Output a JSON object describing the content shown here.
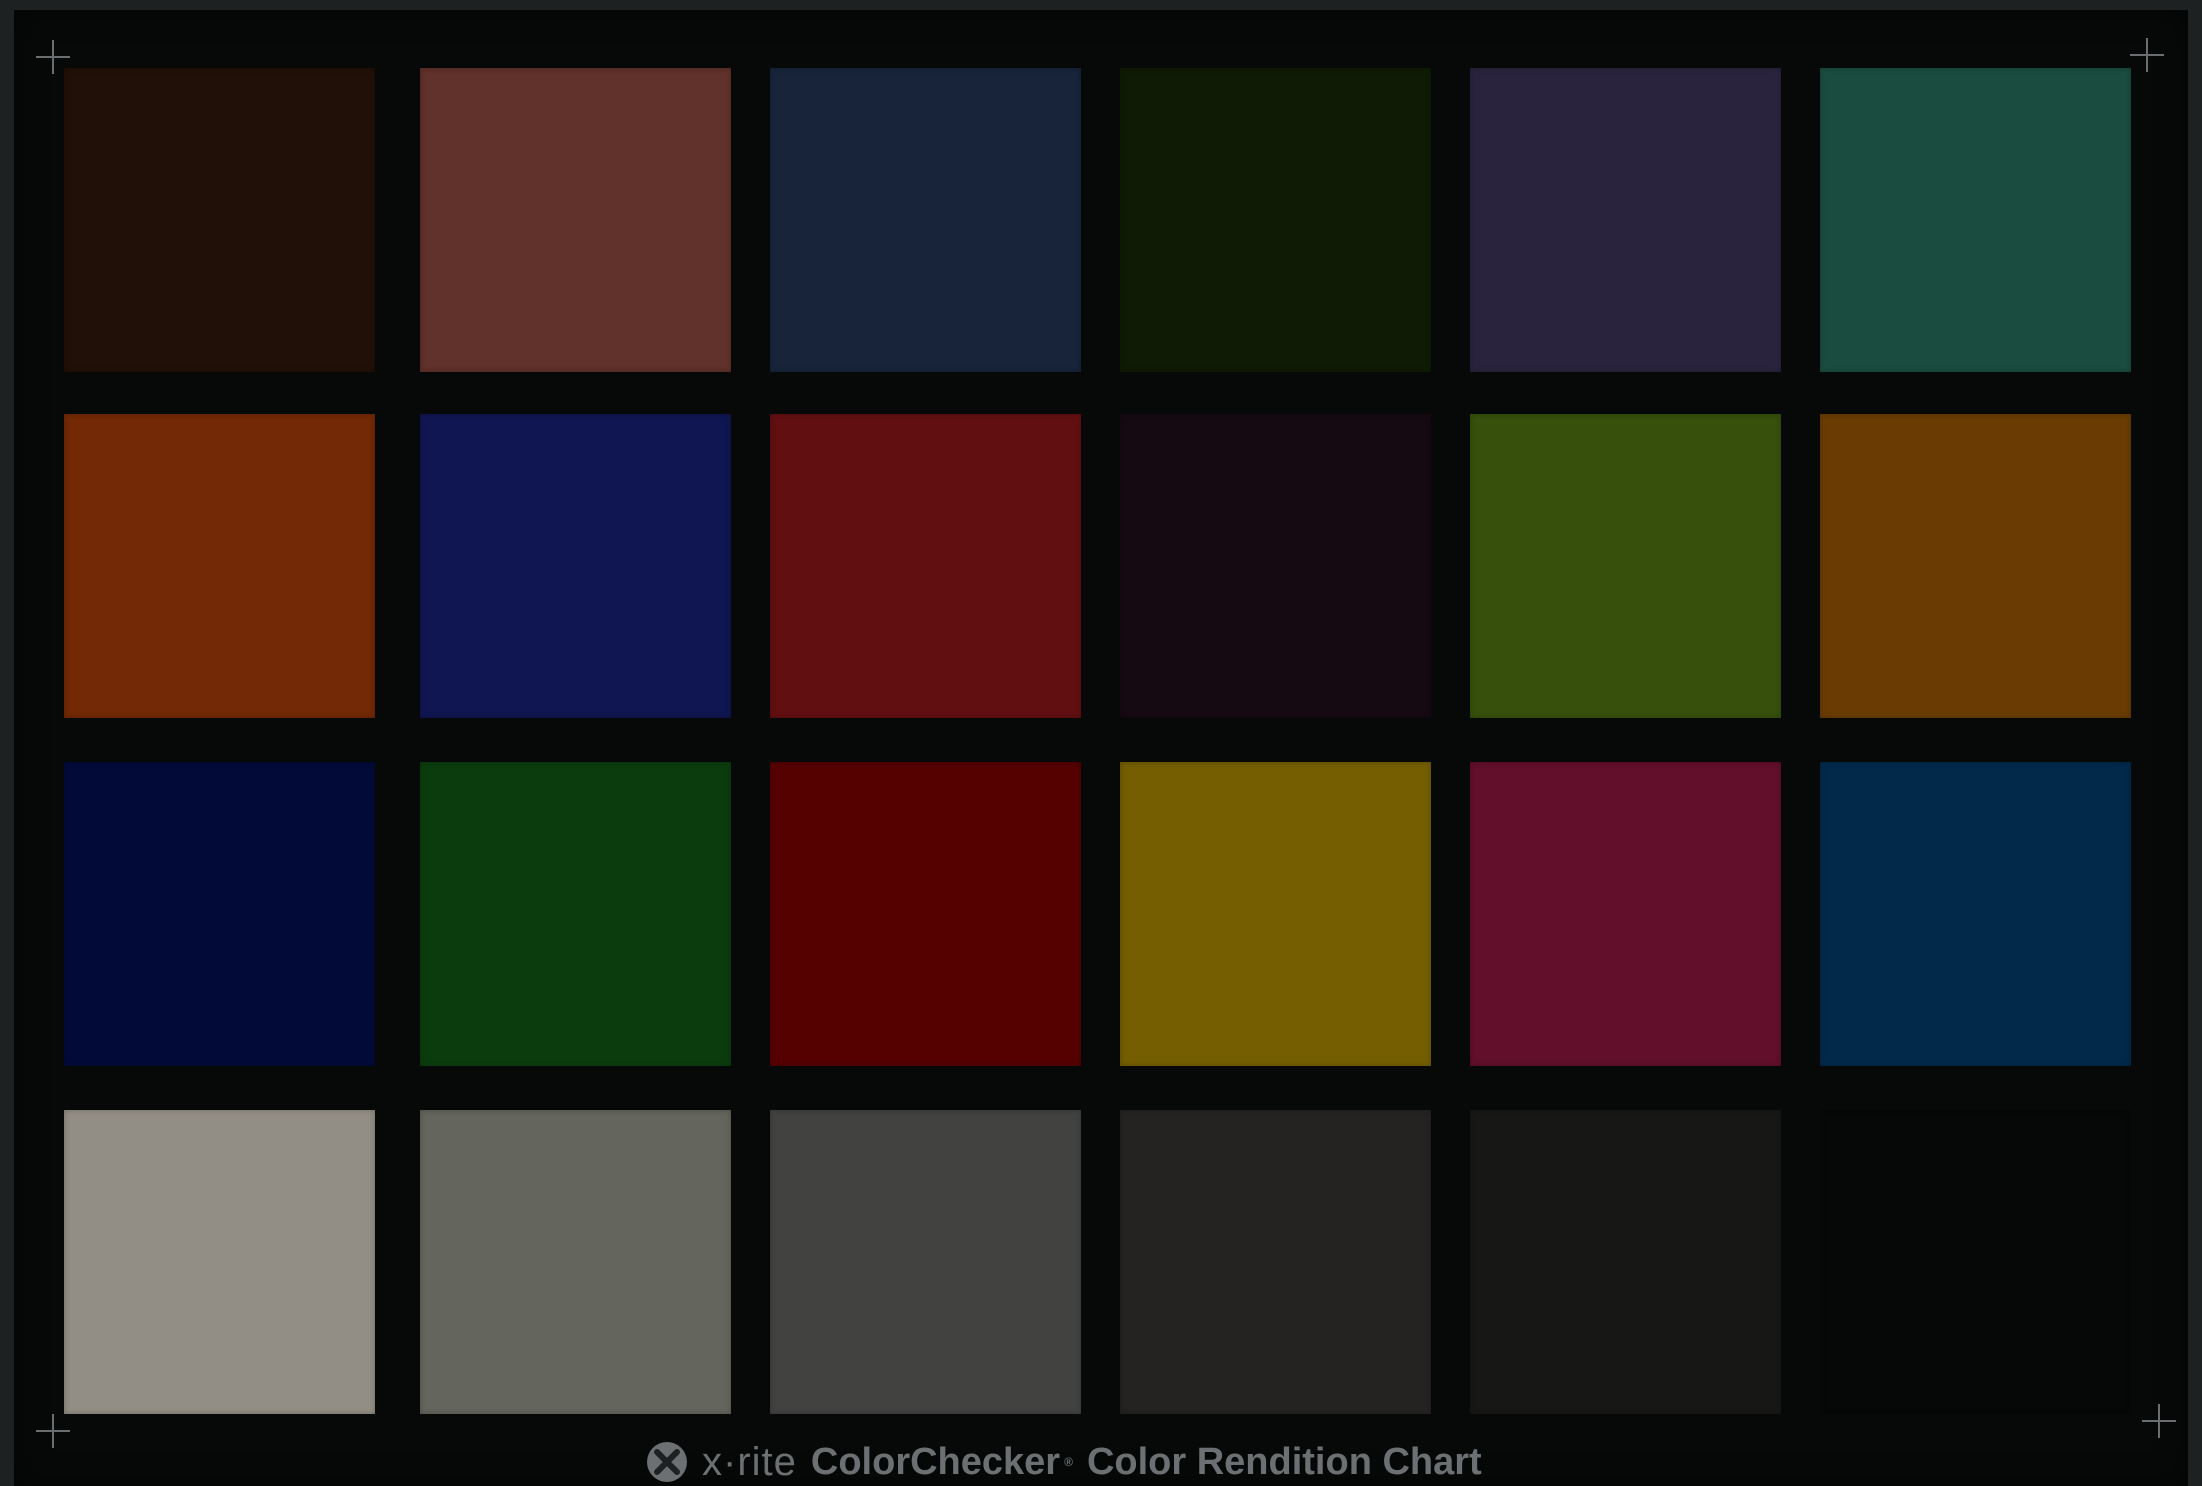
{
  "rows": [
    [
      "#201008",
      "#61312b",
      "#17243a",
      "#0f1b05",
      "#29233d",
      "#1a4d40"
    ],
    [
      "#732905",
      "#0f1651",
      "#620f11",
      "#150912",
      "#37500c",
      "#6a3c03"
    ],
    [
      "#020a38",
      "#0b3c0e",
      "#550100",
      "#745e01",
      "#610f2a",
      "#02294a"
    ],
    [
      "#938e85",
      "#64655d",
      "#424241",
      "#242322",
      "#171716",
      "#060707"
    ]
  ],
  "footer": {
    "brand": "x·rite",
    "product": "ColorChecker",
    "registered": "®",
    "subtitle": "Color Rendition Chart"
  }
}
